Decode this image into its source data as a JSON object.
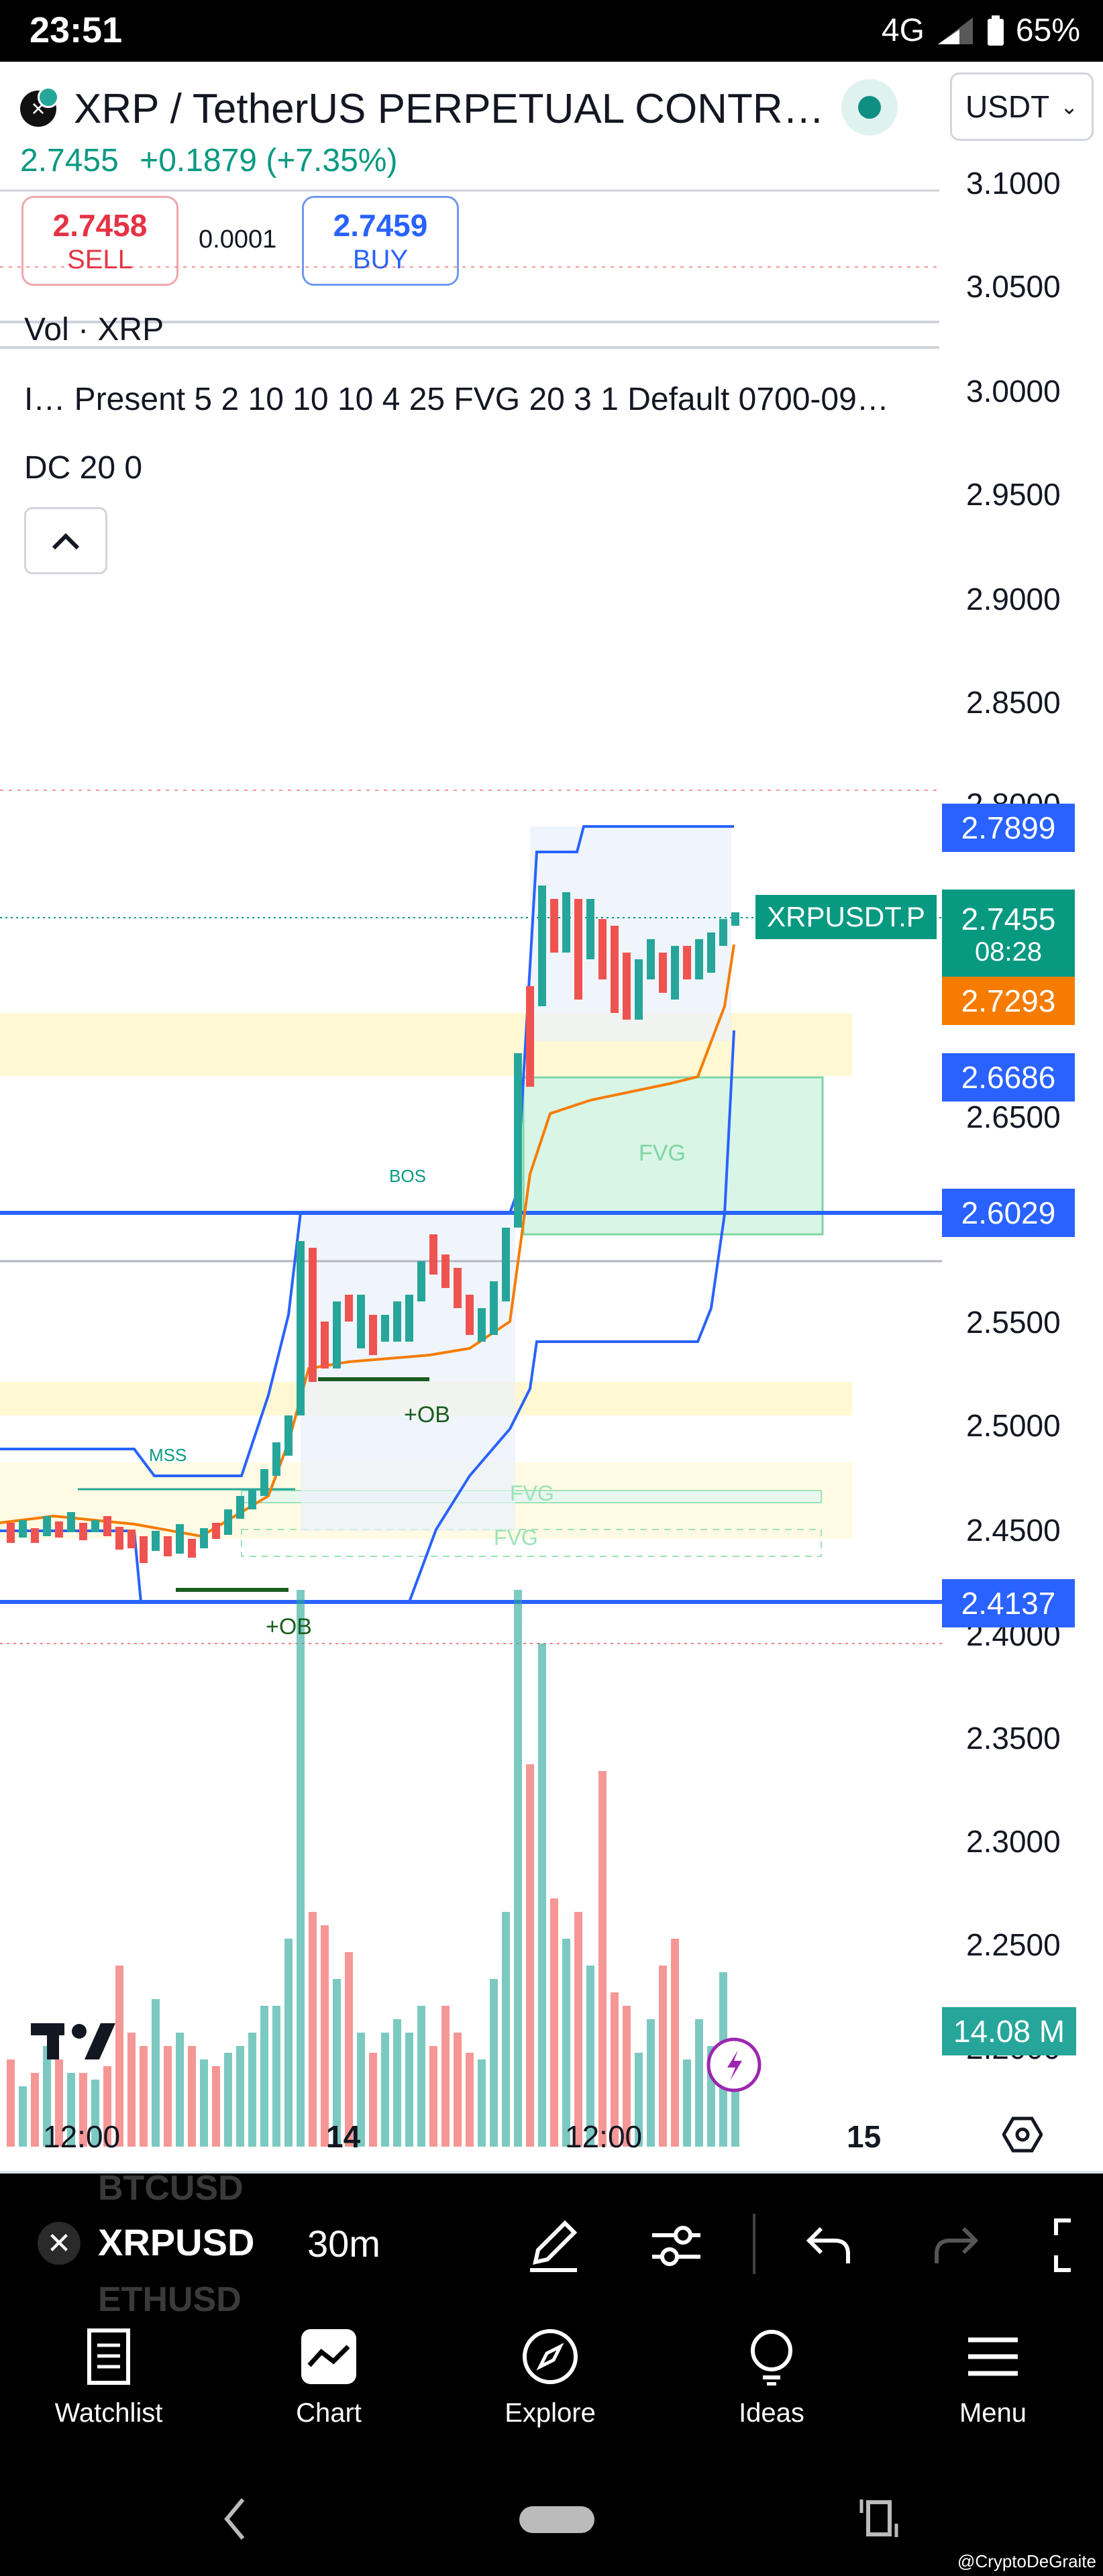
{
  "status_bar": {
    "time": "23:51",
    "network": "4G",
    "battery": "65%"
  },
  "header": {
    "symbol_title": "XRP / TetherUS PERPETUAL CONTR…",
    "currency": "USDT",
    "last_price": "2.7455",
    "change": "+0.1879 (+7.35%)",
    "sell_price": "2.7458",
    "sell_label": "SELL",
    "buy_price": "2.7459",
    "buy_label": "BUY",
    "spread": "0.0001"
  },
  "legends": {
    "volume": "Vol · XRP",
    "indicator": "I…   Present 5 2 10 10 10 4 25 FVG 20 3 1 Default 0700-09…",
    "donchian": "DC 20 0"
  },
  "price_axis": [
    "3.1000",
    "3.0500",
    "3.0000",
    "2.9500",
    "2.9000",
    "2.8500",
    "2.8000",
    "2.6500",
    "2.5500",
    "2.5000",
    "2.4500",
    "2.4000",
    "2.3500",
    "2.3000",
    "2.2500",
    "2.2000"
  ],
  "price_tags": {
    "dc_upper": "2.7899",
    "symbol_label": "XRPUSDT.P",
    "last": "2.7455",
    "countdown": "08:28",
    "dc_mid": "2.7293",
    "dc_lower": "2.6686",
    "level_a": "2.6029",
    "level_b": "2.4137",
    "volume": "14.08 M"
  },
  "annotations": {
    "bos": "BOS",
    "mss": "MSS",
    "fvg": "FVG",
    "ob": "+OB"
  },
  "time_axis": [
    "12:00",
    "14",
    "12:00",
    "15"
  ],
  "toolbar": {
    "symbol": "XRPUSD",
    "ghost_prev": "BTCUSD",
    "ghost_next": "ETHUSD",
    "interval": "30m"
  },
  "nav": [
    "Watchlist",
    "Chart",
    "Explore",
    "Ideas",
    "Menu"
  ],
  "watermark": "@CryptoDeGraite",
  "colors": {
    "up": "#26a69a",
    "down": "#ef5350",
    "dc_line": "#2962ff",
    "mid_line": "#f57c00",
    "accent": "#089981"
  }
}
